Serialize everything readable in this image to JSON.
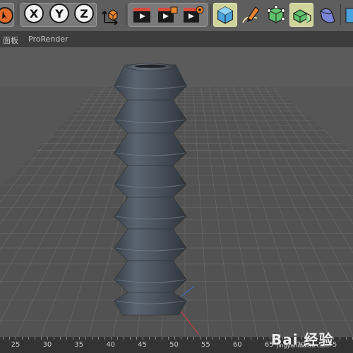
{
  "toolbar": {
    "axis_buttons": [
      {
        "label": "X",
        "name": "x-axis-lock-button"
      },
      {
        "label": "Y",
        "name": "y-axis-lock-button"
      },
      {
        "label": "Z",
        "name": "z-axis-lock-button"
      }
    ],
    "icons": [
      "move-icon",
      "coordinate-system-icon",
      "render-view-icon",
      "render-to-picture-viewer-icon",
      "render-settings-icon",
      "cube-icon",
      "pen-icon",
      "subdivision-surface-icon",
      "array-icon",
      "deformer-icon"
    ]
  },
  "menubar": {
    "items": [
      "面板",
      "ProRender"
    ]
  },
  "timeline": {
    "ticks": [
      "25",
      "30",
      "35",
      "40",
      "45",
      "50",
      "55",
      "60",
      "65",
      "70",
      "75"
    ]
  },
  "watermark": {
    "brand": "Bai 经验",
    "url": "jingyan.baidu.com"
  },
  "colors": {
    "toolbar_bg": "#5e5e5e",
    "viewport_bg": "#4a4a4a",
    "object_color": "#4f5862",
    "active_button": "#cfd49a"
  }
}
